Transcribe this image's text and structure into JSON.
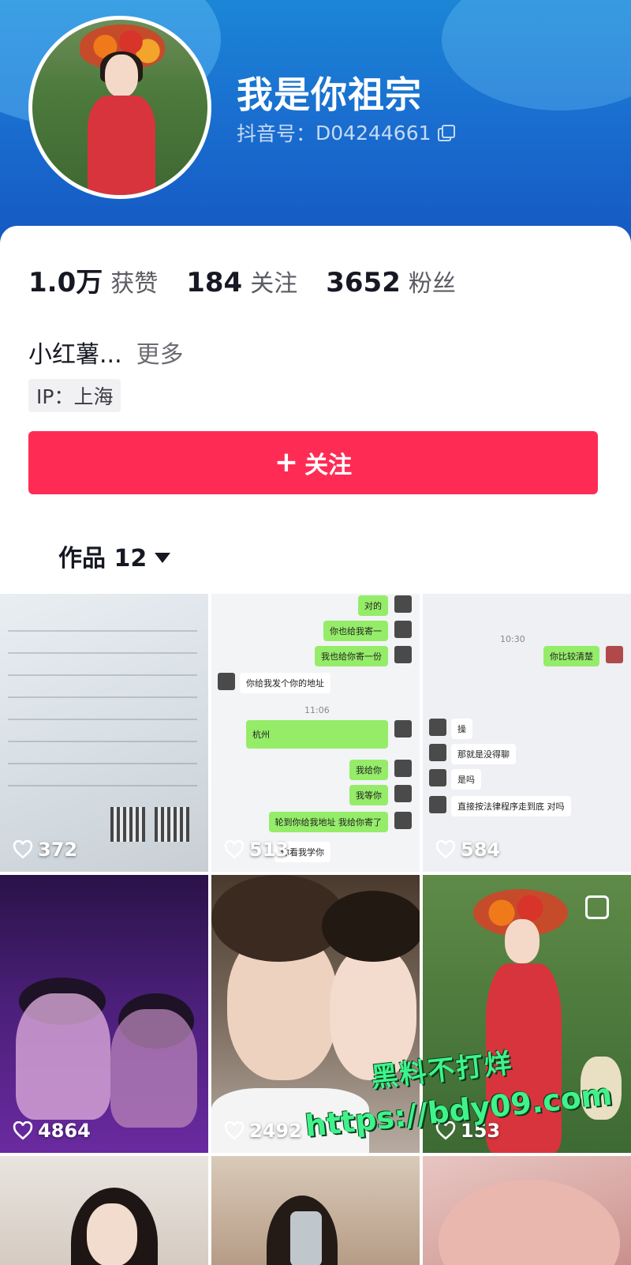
{
  "profile": {
    "nickname": "我是你祖宗",
    "douyin_id_label": "抖音号：",
    "douyin_id": "D04244661"
  },
  "stats": {
    "likes_value": "1.0万",
    "likes_label": "获赞",
    "following_value": "184",
    "following_label": "关注",
    "followers_value": "3652",
    "followers_label": "粉丝"
  },
  "bio": {
    "text": "小红薯...",
    "more": "更多"
  },
  "ip": "IP：上海",
  "follow_button": {
    "plus": "+",
    "label": "关注"
  },
  "works_tab": {
    "label": "作品 12"
  },
  "videos": [
    {
      "likes": "372"
    },
    {
      "likes": "513"
    },
    {
      "likes": "584"
    },
    {
      "likes": "4864"
    },
    {
      "likes": "2492"
    },
    {
      "likes": "153"
    }
  ],
  "chat_preview": {
    "b1": "对的",
    "b2": "你也给我寄一",
    "b3": "我也给你寄一份",
    "b4": "你给我发个你的地址",
    "b5": "11:06",
    "b6": "杭州",
    "b7": "我给你",
    "b8": "我等你",
    "b9": "轮到你给我地址 我给你寄了",
    "b10": "你看我学你",
    "c1": "你比较清楚",
    "c2": "10:30",
    "c3": "操",
    "c4": "那就是没得聊",
    "c5": "是吗",
    "c6": "直接按法律程序走到底 对吗"
  },
  "watermark": {
    "line1": "黑料不打烊",
    "line2": "https://bdy09.com"
  },
  "colors": {
    "brand_red": "#fe2c55",
    "header_blue": "#1a6fd0",
    "watermark_green": "#3ff38a"
  }
}
